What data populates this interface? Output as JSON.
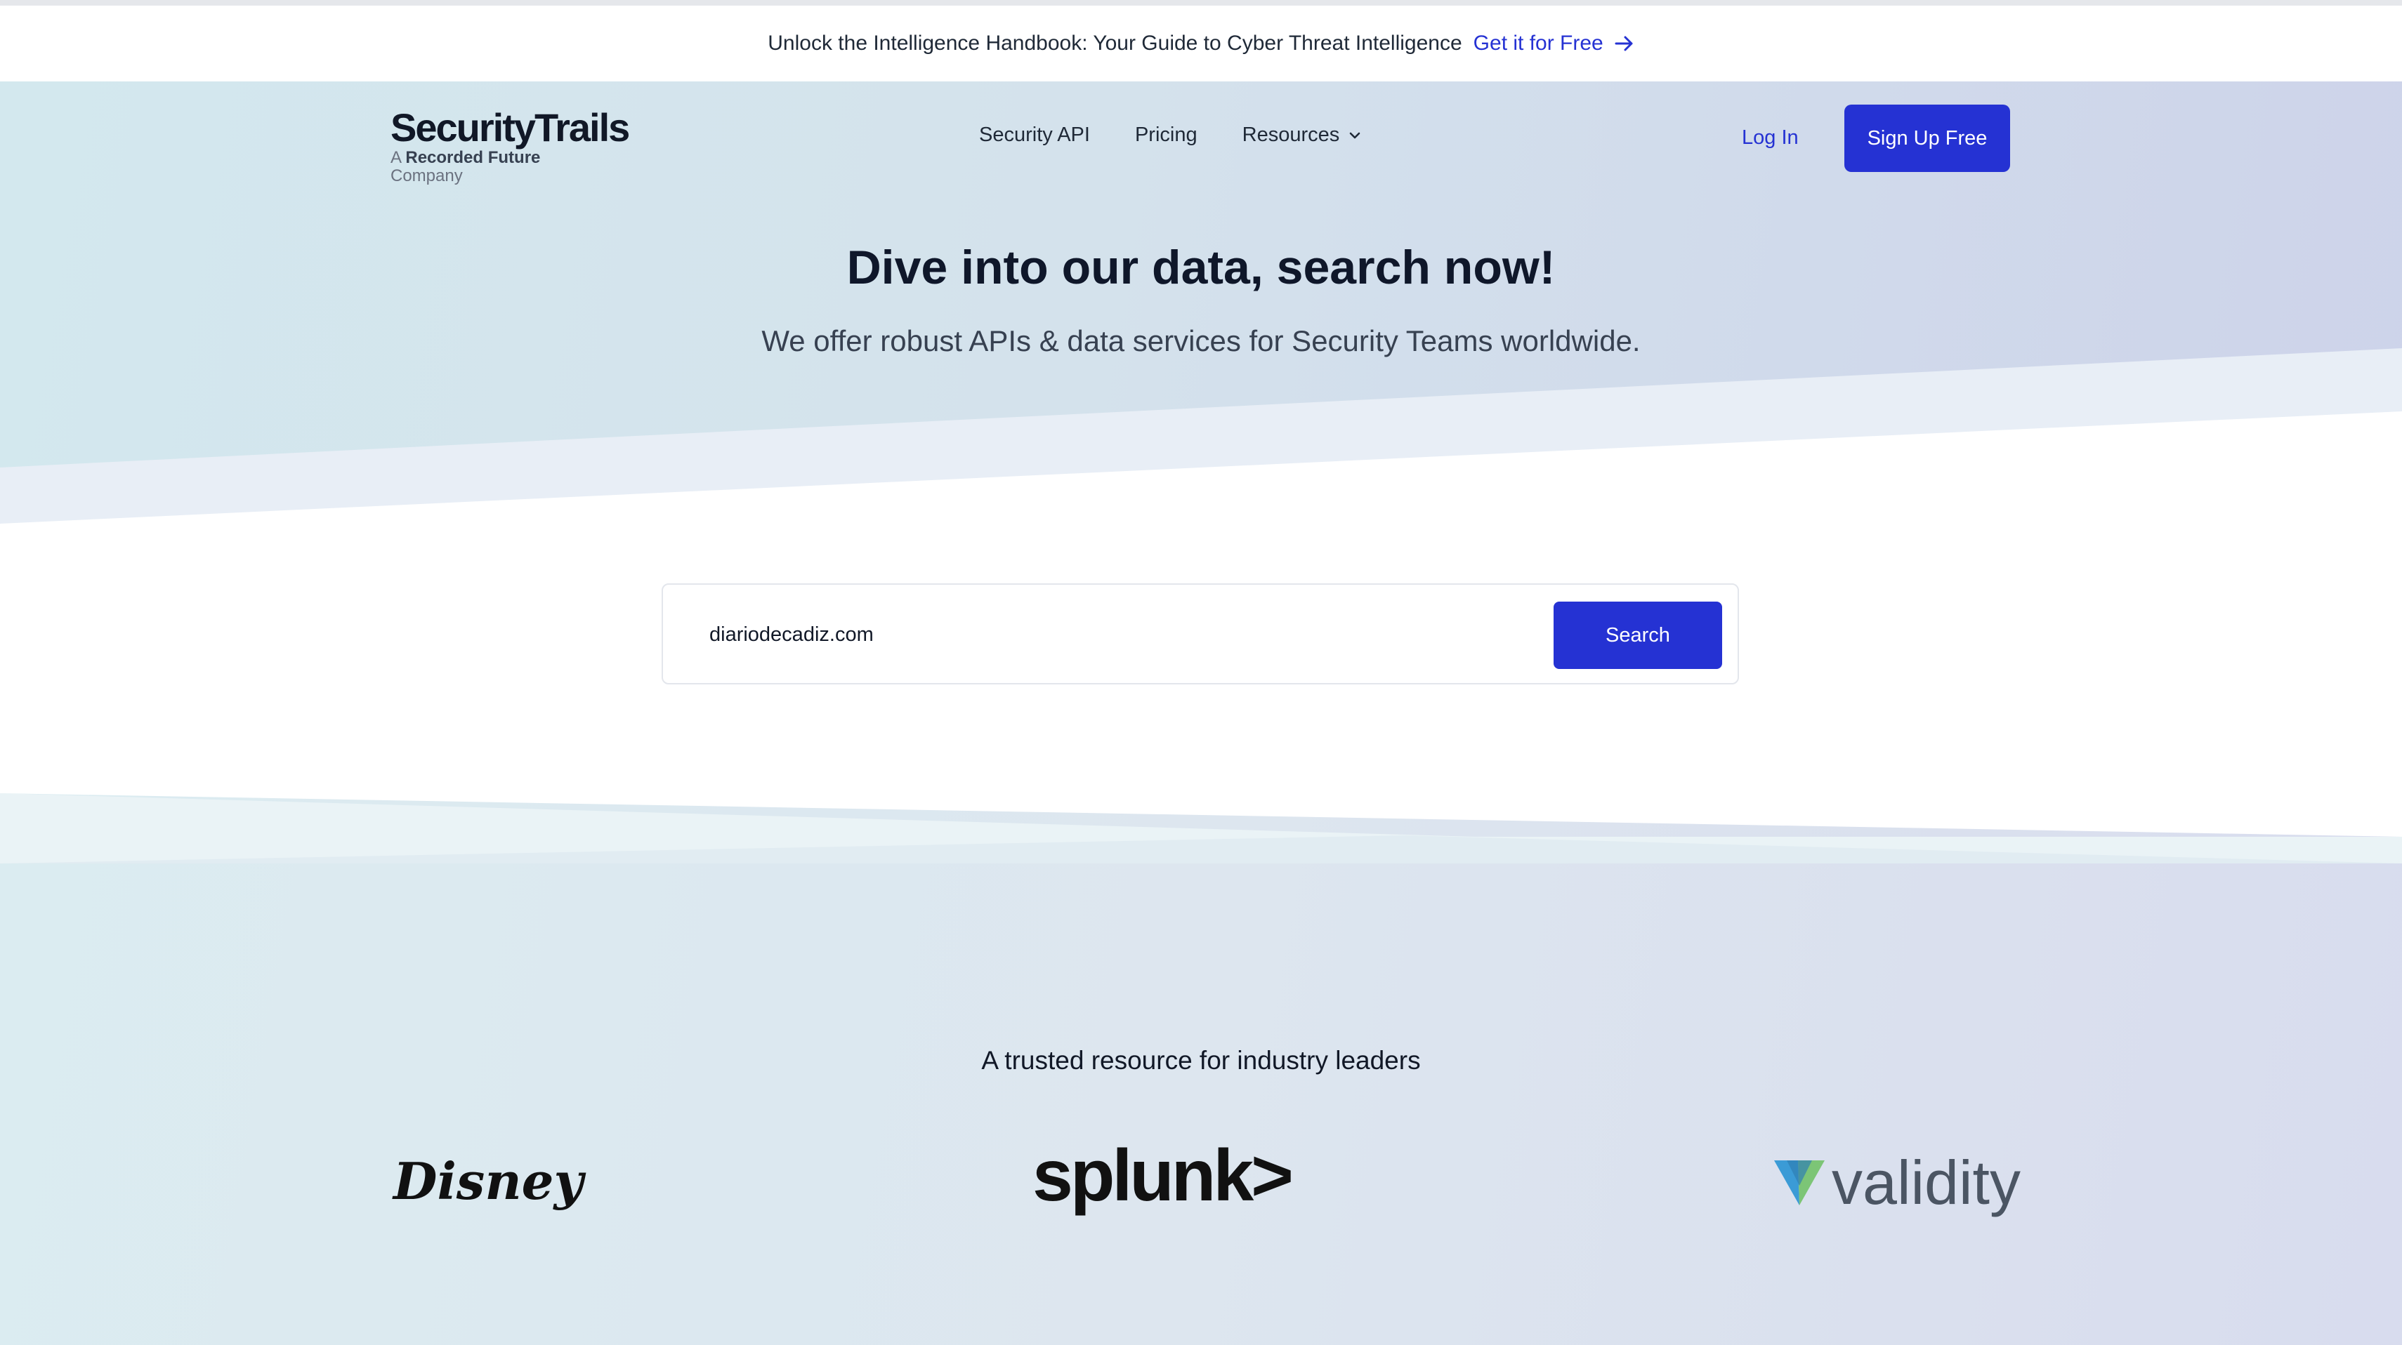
{
  "announcement": {
    "text": "Unlock the Intelligence Handbook: Your Guide to Cyber Threat Intelligence",
    "cta_label": "Get it for Free"
  },
  "logo": {
    "name": "SecurityTrails",
    "tagline_prefix": "A",
    "tagline_brand": "Recorded Future",
    "tagline_suffix": "Company"
  },
  "nav": {
    "items": [
      {
        "label": "Security API"
      },
      {
        "label": "Pricing"
      },
      {
        "label": "Resources"
      }
    ],
    "login_label": "Log In",
    "signup_label": "Sign Up Free"
  },
  "hero": {
    "title": "Dive into our data, search now!",
    "subtitle": "We offer robust APIs & data services for Security Teams worldwide."
  },
  "search": {
    "value": "diariodecadiz.com",
    "button_label": "Search"
  },
  "trusted": {
    "heading": "A trusted resource for industry leaders",
    "brands": [
      "Disney",
      "splunk>",
      "validity"
    ]
  },
  "colors": {
    "accent": "#2532d3",
    "text": "#111827"
  }
}
